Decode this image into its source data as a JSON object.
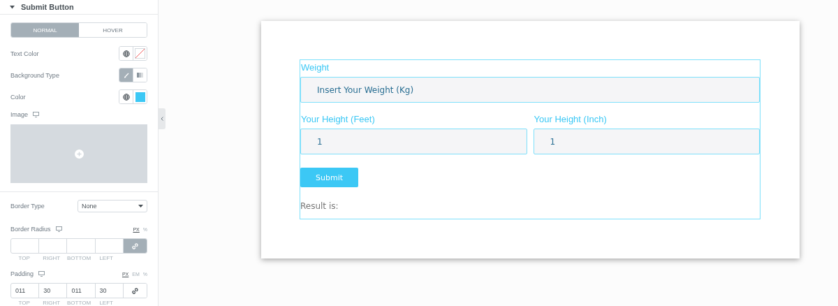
{
  "panel": {
    "section_title": "Submit Button",
    "expanded": true,
    "tabs": [
      {
        "label": "NORMAL",
        "selected": true
      },
      {
        "label": "HOVER",
        "selected": false
      }
    ],
    "text_color": {
      "label": "Text Color"
    },
    "background_type": {
      "label": "Background Type",
      "options": [
        {
          "kind": "classic",
          "selected": true
        },
        {
          "kind": "gradient",
          "selected": false
        }
      ]
    },
    "color": {
      "label": "Color",
      "color": "#3cc8f5"
    },
    "image": {
      "label": "Image"
    },
    "border_type": {
      "label": "Border Type",
      "value": "None"
    },
    "border_radius": {
      "label": "Border Radius",
      "units": [
        {
          "label": "PX",
          "selected": true
        },
        {
          "label": "%",
          "selected": false
        }
      ],
      "linked": true,
      "sides": [
        "TOP",
        "RIGHT",
        "BOTTOM",
        "LEFT"
      ]
    },
    "padding": {
      "label": "Padding",
      "units": [
        {
          "label": "PX",
          "selected": true
        },
        {
          "label": "EM",
          "selected": false
        },
        {
          "label": "%",
          "selected": false
        }
      ],
      "values": [
        "011",
        "30",
        "011",
        "30"
      ],
      "linked": false,
      "sides": [
        "TOP",
        "RIGHT",
        "BOTTOM",
        "LEFT"
      ]
    }
  },
  "form": {
    "weight": {
      "label": "Weight",
      "placeholder": "Insert Your Weight (Kg)"
    },
    "heights": [
      {
        "label": "Your Height (Feet)",
        "value": "1"
      },
      {
        "label": "Your Height (Inch)",
        "value": "1"
      }
    ],
    "submit": "Submit",
    "result": "Result is:"
  }
}
